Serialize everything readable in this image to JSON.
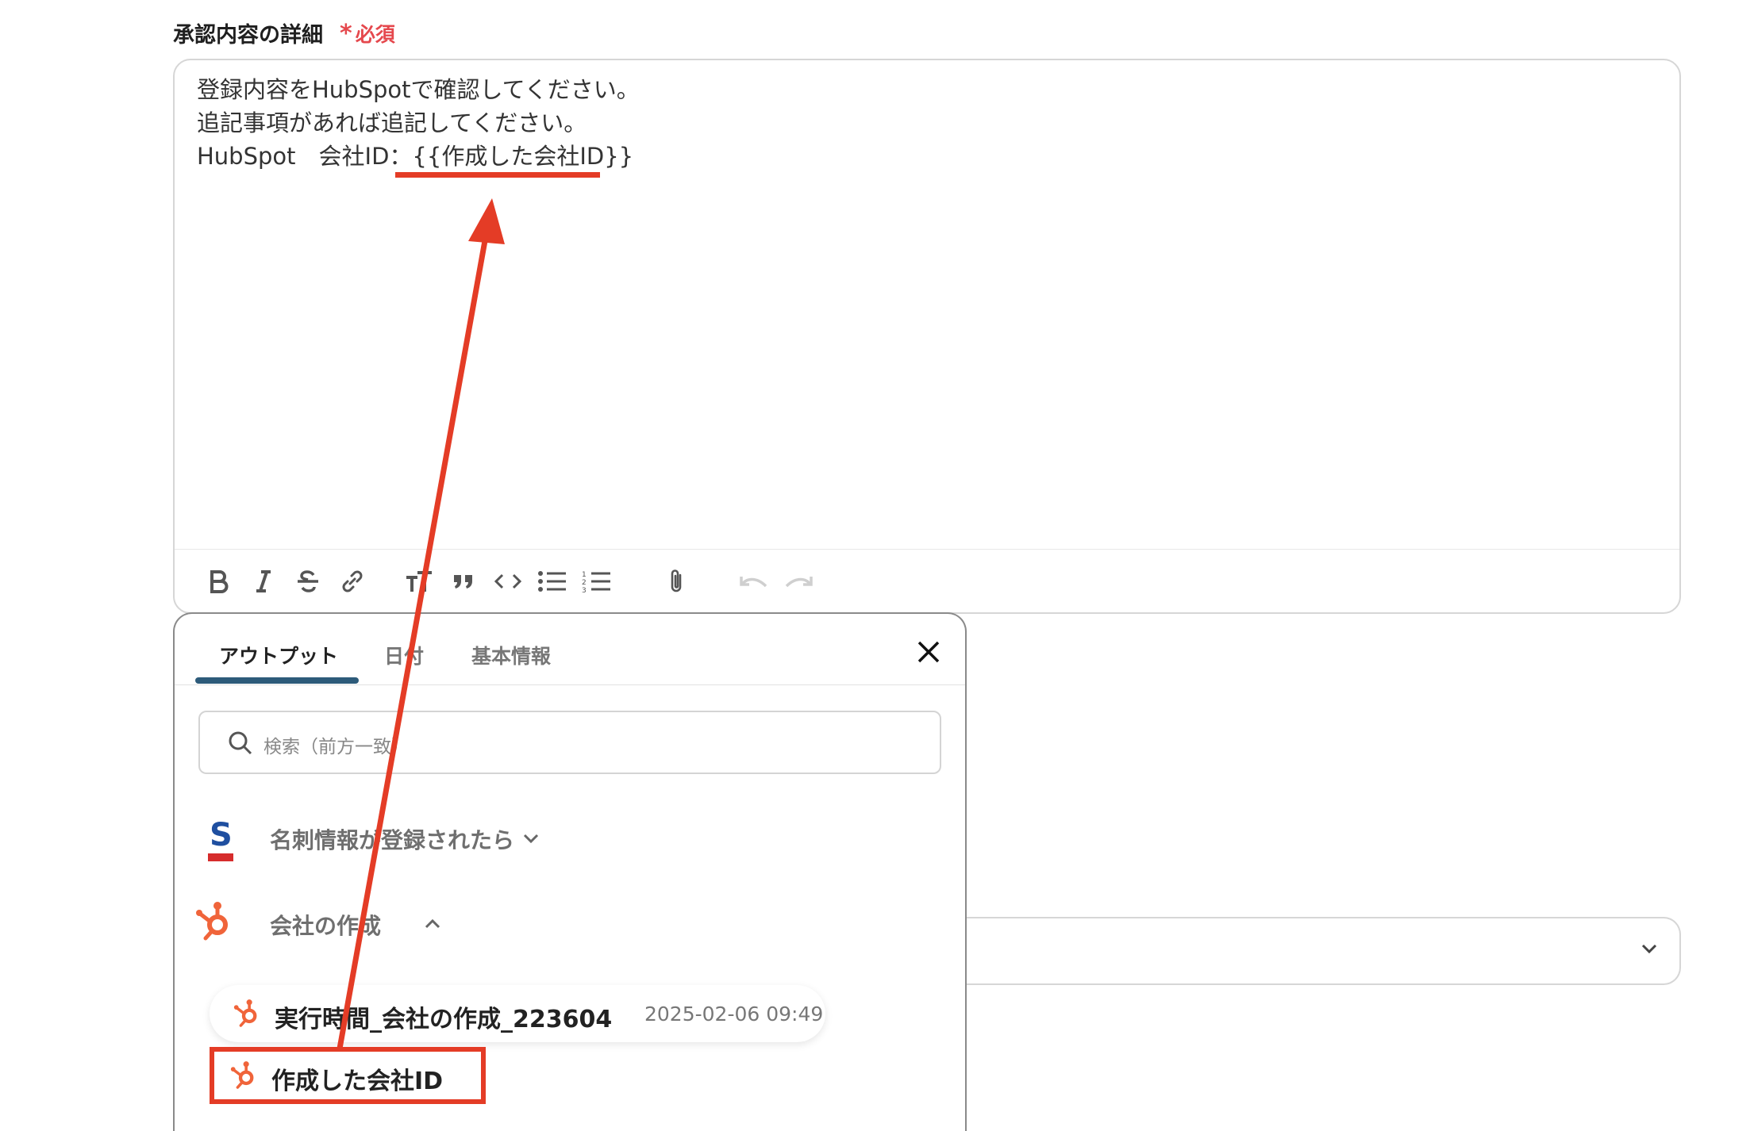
{
  "field": {
    "label": "承認内容の詳細",
    "required": "必須"
  },
  "editor": {
    "lines": [
      "登録内容をHubSpotで確認してください。",
      "追記事項があれば追記してください。"
    ],
    "line3_prefix": "HubSpot　会社ID：",
    "line3_variable": "{{作成した会社ID}}",
    "toolbar": [
      "bold-icon",
      "italic-icon",
      "strikethrough-icon",
      "link-icon",
      "text-size-icon",
      "quote-icon",
      "code-icon",
      "bullet-list-icon",
      "numbered-list-icon",
      "attachment-icon",
      "undo-icon",
      "redo-icon"
    ]
  },
  "picker": {
    "tabs": [
      "アウトプット",
      "日付",
      "基本情報"
    ],
    "active_tab": "アウトプット",
    "search_placeholder": "検索（前方一致）",
    "groups": [
      {
        "label": "名刺情報が登録されたら",
        "icon": "sansan-logo",
        "expanded": false
      },
      {
        "label": "会社の作成",
        "icon": "hubspot-logo",
        "expanded": true
      }
    ],
    "outputs": [
      {
        "name": "実行時間_会社の作成_223604",
        "time": "2025-02-06 09:49"
      },
      {
        "name": "作成した会社ID"
      }
    ]
  },
  "colors": {
    "annotation": "#e43c26",
    "required": "#e5484d",
    "tab_underline": "#2d5b7a",
    "hubspot": "#f0643a",
    "sansan_blue": "#1f4fa0",
    "sansan_red": "#d62c2c"
  }
}
